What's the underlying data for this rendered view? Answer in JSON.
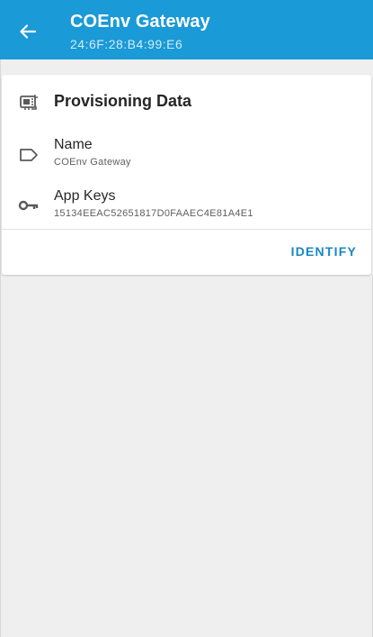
{
  "app_bar": {
    "title": "COEnv Gateway",
    "subtitle": "24:6F:28:B4:99:E6",
    "back_icon": "arrow-back-icon",
    "color": "#1a9ad6"
  },
  "card": {
    "header": {
      "title": "Provisioning Data",
      "icon": "chip-icon"
    },
    "rows": [
      {
        "label": "Name",
        "value": "COEnv Gateway",
        "icon": "label-tag-icon"
      },
      {
        "label": "App Keys",
        "value": "15134EEAC52651817D0FAAEC4E81A4E1",
        "icon": "key-icon"
      }
    ],
    "action": {
      "label": "IDENTIFY",
      "color": "#1a86c4"
    }
  }
}
